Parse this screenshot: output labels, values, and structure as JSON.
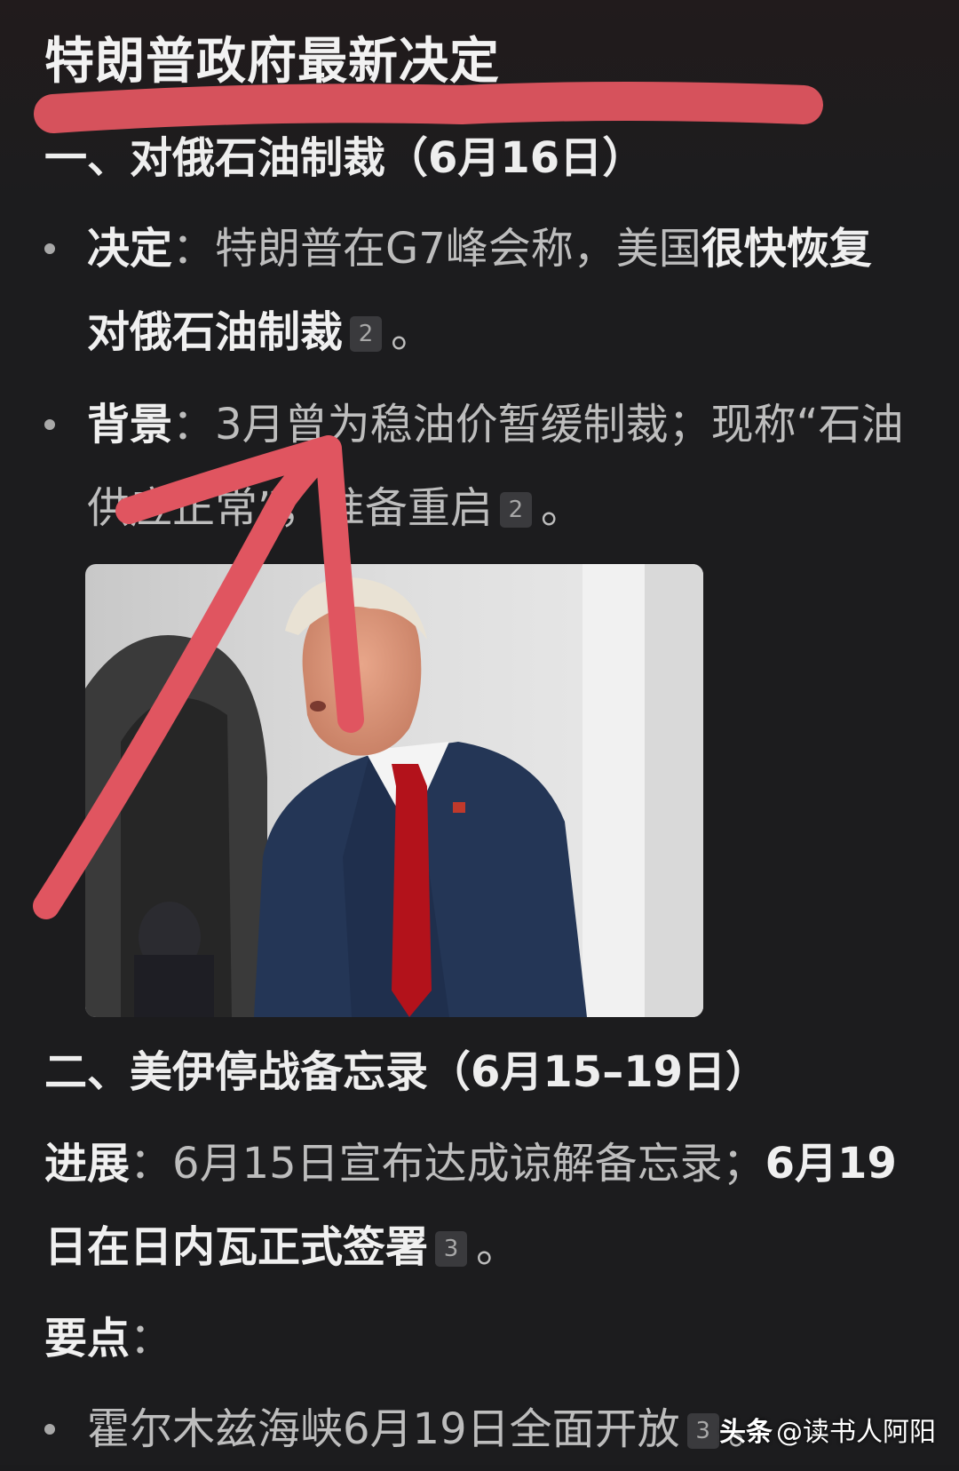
{
  "title": "特朗普政府最新决定",
  "section1": {
    "heading": "一、对俄石油制裁（6月16日）",
    "items": [
      {
        "label": "决定",
        "sep": "：",
        "text": "特朗普在G7峰会称，美国",
        "bold": "很快恢复对俄石油制裁",
        "cite": "2",
        "end": "。"
      },
      {
        "label": "背景",
        "sep": "：",
        "text": "3月曾为稳油价暂缓制裁；现称“石油供应正常”，准备重启",
        "cite": "2",
        "end": "。"
      }
    ]
  },
  "section2": {
    "heading": "二、美伊停战备忘录（6月15–19日）",
    "progress": {
      "label": "进展",
      "sep": "：",
      "text": "6月15日宣布达成谅解备忘录；",
      "bold": "6月19日在日内瓦正式签署",
      "cite": "3",
      "end": "。"
    },
    "keypoints_label": "要点",
    "keypoints_sep": "：",
    "items": [
      {
        "text": "霍尔木兹海峡6月19日全面开放",
        "cite": "3",
        "end": "。"
      }
    ]
  },
  "watermark": {
    "logo": "头条",
    "handle": "@读书人阿阳"
  },
  "colors": {
    "background": "#1c1c1e",
    "annotation": "#e05560",
    "tie": "#b3121b",
    "suit": "#243656"
  },
  "annotations": {
    "underline": "red-freehand-underline",
    "arrow": "red-freehand-arrow"
  }
}
